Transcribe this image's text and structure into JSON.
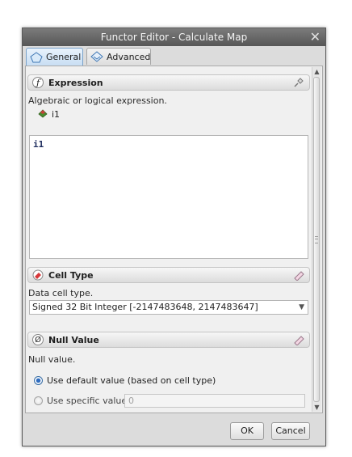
{
  "window": {
    "title": "Functor Editor - Calculate Map",
    "close_glyph": "✕"
  },
  "tabs": [
    {
      "label": "General",
      "icon": "pentagon-icon",
      "active": true
    },
    {
      "label": "Advanced",
      "icon": "diamond-icon",
      "active": false
    }
  ],
  "expression": {
    "icon": "function-icon",
    "icon_glyph": "ƒ",
    "title": "Expression",
    "description": "Algebraic or logical expression.",
    "variable": "i1",
    "value": "i1",
    "action_icon": "pin-icon"
  },
  "cell_type": {
    "icon": "eraser-icon",
    "title": "Cell Type",
    "description": "Data cell type.",
    "selected": "Signed 32 Bit Integer [-2147483648, 2147483647]",
    "action_icon": "edit-icon"
  },
  "null_value": {
    "icon": "null-icon",
    "icon_glyph": "Ø",
    "title": "Null Value",
    "description": "Null value.",
    "option_default": "Use default value (based on cell type)",
    "option_specific": "Use specific value",
    "specific_value": "0",
    "selected_option": "default",
    "action_icon": "edit-icon"
  },
  "buttons": {
    "ok": "OK",
    "cancel": "Cancel"
  },
  "colors": {
    "titlebar": "#666666",
    "accent": "#2f6cc0"
  }
}
